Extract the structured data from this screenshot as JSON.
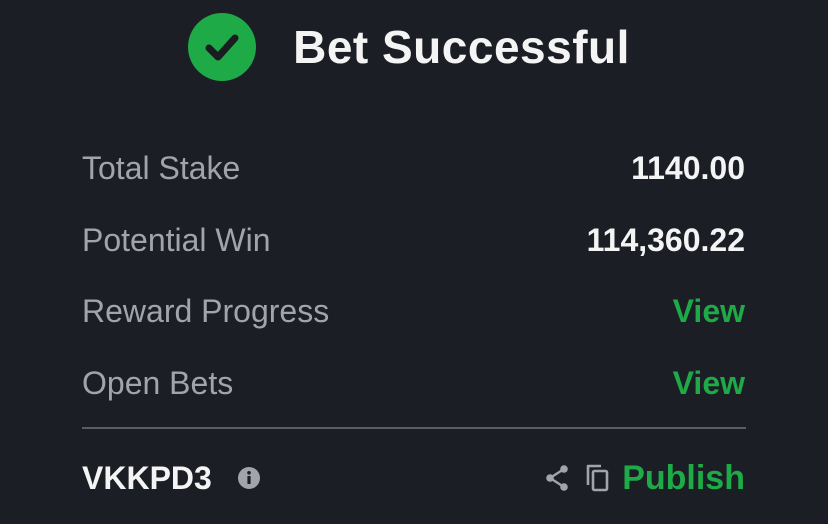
{
  "header": {
    "icon": "check-circle-icon",
    "title": "Bet Successful"
  },
  "summary": {
    "rows": [
      {
        "label": "Total Stake",
        "value": "1140.00"
      },
      {
        "label": "Potential Win",
        "value": "114,360.22"
      },
      {
        "label": "Reward Progress",
        "value": "View"
      },
      {
        "label": "Open Bets",
        "value": "View"
      }
    ]
  },
  "footer": {
    "booking_code": "VKKPD3",
    "info_icon": "info-icon",
    "share_icon": "share-icon",
    "copy_icon": "copy-icon",
    "publish_label": "Publish"
  },
  "colors": {
    "background": "#1c1e25",
    "accent_green": "#1eaa46",
    "text_primary": "#f4f4f4",
    "text_secondary": "#a2a4aa"
  }
}
